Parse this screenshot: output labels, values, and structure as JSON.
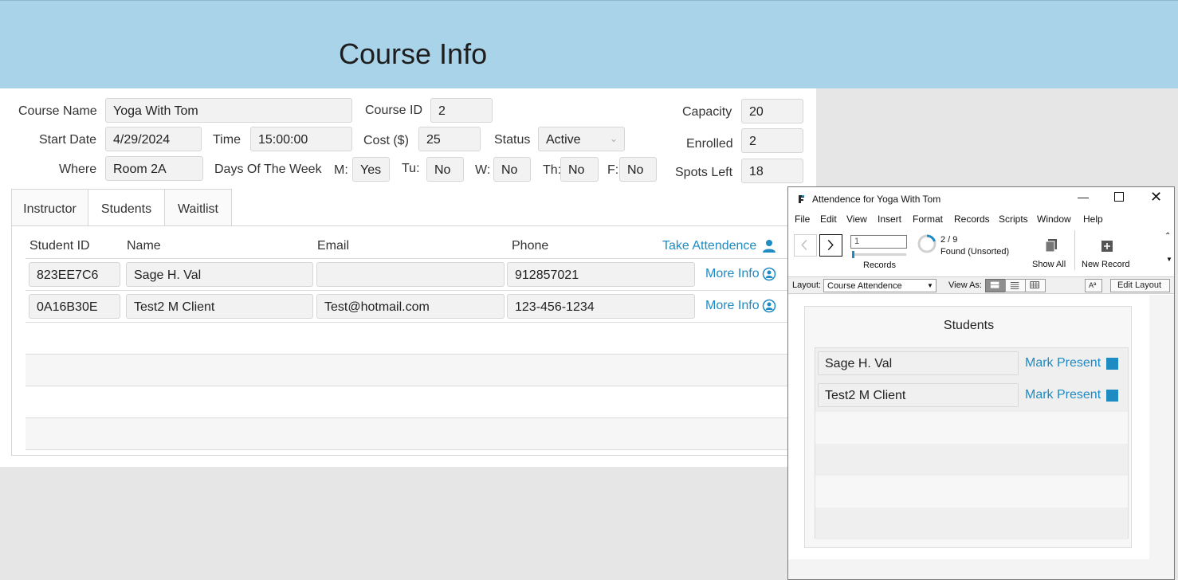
{
  "header": {
    "title": "Course Info"
  },
  "course": {
    "name_label": "Course Name",
    "name_value": "Yoga With Tom",
    "id_label": "Course ID",
    "id_value": "2",
    "capacity_label": "Capacity",
    "capacity_value": "20",
    "start_label": "Start Date",
    "start_value": "4/29/2024",
    "time_label": "Time",
    "time_value": "15:00:00",
    "cost_label": "Cost ($)",
    "cost_value": "25",
    "status_label": "Status",
    "status_value": "Active",
    "enrolled_label": "Enrolled",
    "enrolled_value": "2",
    "where_label": "Where",
    "where_value": "Room 2A",
    "days_label": "Days Of The Week",
    "mon_label": "M:",
    "mon_value": "Yes",
    "tue_label": "Tu:",
    "tue_value": "No",
    "wed_label": "W:",
    "wed_value": "No",
    "thu_label": "Th:",
    "thu_value": "No",
    "fri_label": "F:",
    "fri_value": "No",
    "spots_label": "Spots Left",
    "spots_value": "18"
  },
  "tabs": [
    {
      "label": "Instructor"
    },
    {
      "label": "Students"
    },
    {
      "label": "Waitlist"
    }
  ],
  "students": {
    "columns": {
      "id": "Student ID",
      "name": "Name",
      "email": "Email",
      "phone": "Phone"
    },
    "take_attendance": "Take Attendence",
    "rows": [
      {
        "id": "823EE7C6",
        "name": "Sage H. Val",
        "email": "",
        "phone": "912857021",
        "more": "More Info"
      },
      {
        "id": "0A16B30E",
        "name": "Test2 M Client",
        "email": "Test@hotmail.com",
        "phone": "123-456-1234",
        "more": "More Info"
      }
    ]
  },
  "window": {
    "title": "Attendence for Yoga With Tom",
    "menu": [
      "File",
      "Edit",
      "View",
      "Insert",
      "Format",
      "Records",
      "Scripts",
      "Window",
      "Help"
    ],
    "record_input": "1",
    "records_label": "Records",
    "found_count": "2 / 9",
    "found_label": "Found (Unsorted)",
    "show_all": "Show All",
    "new_record": "New Record",
    "layout_label": "Layout:",
    "layout_value": "Course Attendence",
    "view_as_label": "View As:",
    "aa_label": "Aª",
    "edit_layout": "Edit Layout",
    "portal_title": "Students",
    "attendees": [
      {
        "name": "Sage H. Val",
        "action": "Mark Present"
      },
      {
        "name": "Test2 M Client",
        "action": "Mark Present"
      }
    ]
  },
  "colors": {
    "header_bg": "#a9d3e8",
    "link": "#1e8bc3",
    "accent_square": "#1e8bc3"
  }
}
